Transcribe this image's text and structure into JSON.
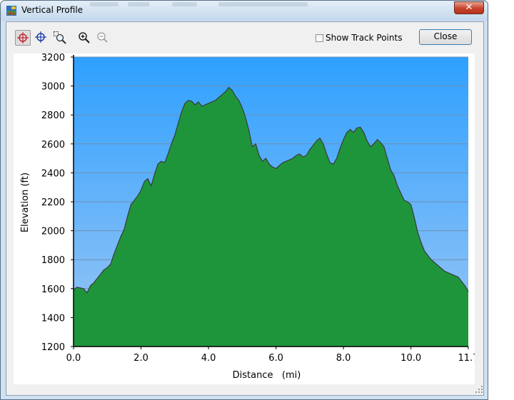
{
  "window": {
    "title": "Vertical Profile",
    "close_glyph": "✕"
  },
  "toolbar": {
    "tools": [
      {
        "name": "crosshair-red-icon",
        "active": true
      },
      {
        "name": "crosshair-blue-icon",
        "active": false
      },
      {
        "name": "zoom-select-icon",
        "active": false
      },
      {
        "name": "zoom-in-icon",
        "active": false
      },
      {
        "name": "zoom-out-icon",
        "active": false
      }
    ],
    "show_track_points_label": "Show Track Points",
    "show_track_points_checked": false,
    "close_label": "Close"
  },
  "chart_data": {
    "type": "area",
    "xlabel": "Distance   (mi)",
    "ylabel": "Elevation (ft)",
    "xlim": [
      0,
      11.7
    ],
    "ylim": [
      1200,
      3200
    ],
    "x_ticks": [
      {
        "v": 0,
        "label": "0.0"
      },
      {
        "v": 2,
        "label": "2.0"
      },
      {
        "v": 4,
        "label": "4.0"
      },
      {
        "v": 6,
        "label": "6.0"
      },
      {
        "v": 8,
        "label": "8.0"
      },
      {
        "v": 10,
        "label": "10.0"
      },
      {
        "v": 11.7,
        "label": "11.7"
      }
    ],
    "y_ticks": [
      {
        "v": 1200,
        "label": "1200"
      },
      {
        "v": 1400,
        "label": "1400"
      },
      {
        "v": 1600,
        "label": "1600"
      },
      {
        "v": 1800,
        "label": "1800"
      },
      {
        "v": 2000,
        "label": "2000"
      },
      {
        "v": 2200,
        "label": "2200"
      },
      {
        "v": 2400,
        "label": "2400"
      },
      {
        "v": 2600,
        "label": "2600"
      },
      {
        "v": 2800,
        "label": "2800"
      },
      {
        "v": 3000,
        "label": "3000"
      },
      {
        "v": 3200,
        "label": "3200"
      }
    ],
    "grid": true,
    "colors": {
      "sky_top": "#2ea0ff",
      "sky_bottom": "#9cc7f4",
      "fill_light": "#2db04a",
      "fill_dark": "#117a2c",
      "outline": "#3a3a3a",
      "gridline": "#6f8fb4"
    },
    "x": [
      0,
      0.1,
      0.2,
      0.3,
      0.4,
      0.5,
      0.6,
      0.7,
      0.8,
      0.9,
      1.0,
      1.1,
      1.2,
      1.3,
      1.4,
      1.5,
      1.6,
      1.7,
      1.8,
      1.9,
      2.0,
      2.1,
      2.2,
      2.3,
      2.4,
      2.5,
      2.6,
      2.7,
      2.8,
      2.9,
      3.0,
      3.1,
      3.2,
      3.3,
      3.4,
      3.5,
      3.6,
      3.7,
      3.8,
      3.9,
      4.0,
      4.1,
      4.2,
      4.3,
      4.4,
      4.5,
      4.6,
      4.7,
      4.8,
      4.9,
      5.0,
      5.1,
      5.2,
      5.3,
      5.4,
      5.5,
      5.6,
      5.7,
      5.8,
      5.9,
      6.0,
      6.1,
      6.2,
      6.3,
      6.4,
      6.5,
      6.6,
      6.7,
      6.8,
      6.9,
      7.0,
      7.1,
      7.2,
      7.3,
      7.4,
      7.5,
      7.6,
      7.7,
      7.8,
      7.9,
      8.0,
      8.1,
      8.2,
      8.3,
      8.4,
      8.5,
      8.6,
      8.7,
      8.8,
      8.9,
      9.0,
      9.1,
      9.2,
      9.3,
      9.4,
      9.5,
      9.6,
      9.7,
      9.8,
      9.9,
      10.0,
      10.1,
      10.2,
      10.3,
      10.4,
      10.5,
      10.6,
      10.7,
      10.8,
      10.9,
      11.0,
      11.1,
      11.2,
      11.3,
      11.4,
      11.5,
      11.6,
      11.7
    ],
    "y": [
      1590,
      1610,
      1605,
      1600,
      1570,
      1620,
      1640,
      1670,
      1700,
      1730,
      1745,
      1770,
      1840,
      1900,
      1960,
      2010,
      2100,
      2180,
      2210,
      2240,
      2280,
      2340,
      2360,
      2310,
      2390,
      2460,
      2480,
      2470,
      2530,
      2600,
      2660,
      2740,
      2820,
      2880,
      2900,
      2895,
      2870,
      2890,
      2860,
      2870,
      2880,
      2890,
      2900,
      2920,
      2940,
      2960,
      2990,
      2970,
      2930,
      2900,
      2850,
      2780,
      2690,
      2580,
      2600,
      2520,
      2480,
      2500,
      2460,
      2440,
      2430,
      2450,
      2470,
      2480,
      2490,
      2500,
      2520,
      2530,
      2510,
      2520,
      2560,
      2590,
      2620,
      2640,
      2600,
      2530,
      2470,
      2460,
      2500,
      2570,
      2630,
      2680,
      2700,
      2680,
      2710,
      2715,
      2680,
      2620,
      2580,
      2600,
      2630,
      2610,
      2580,
      2500,
      2420,
      2380,
      2310,
      2260,
      2210,
      2200,
      2180,
      2090,
      1990,
      1920,
      1860,
      1830,
      1800,
      1780,
      1760,
      1740,
      1720,
      1710,
      1700,
      1690,
      1680,
      1650,
      1620,
      1580
    ]
  }
}
